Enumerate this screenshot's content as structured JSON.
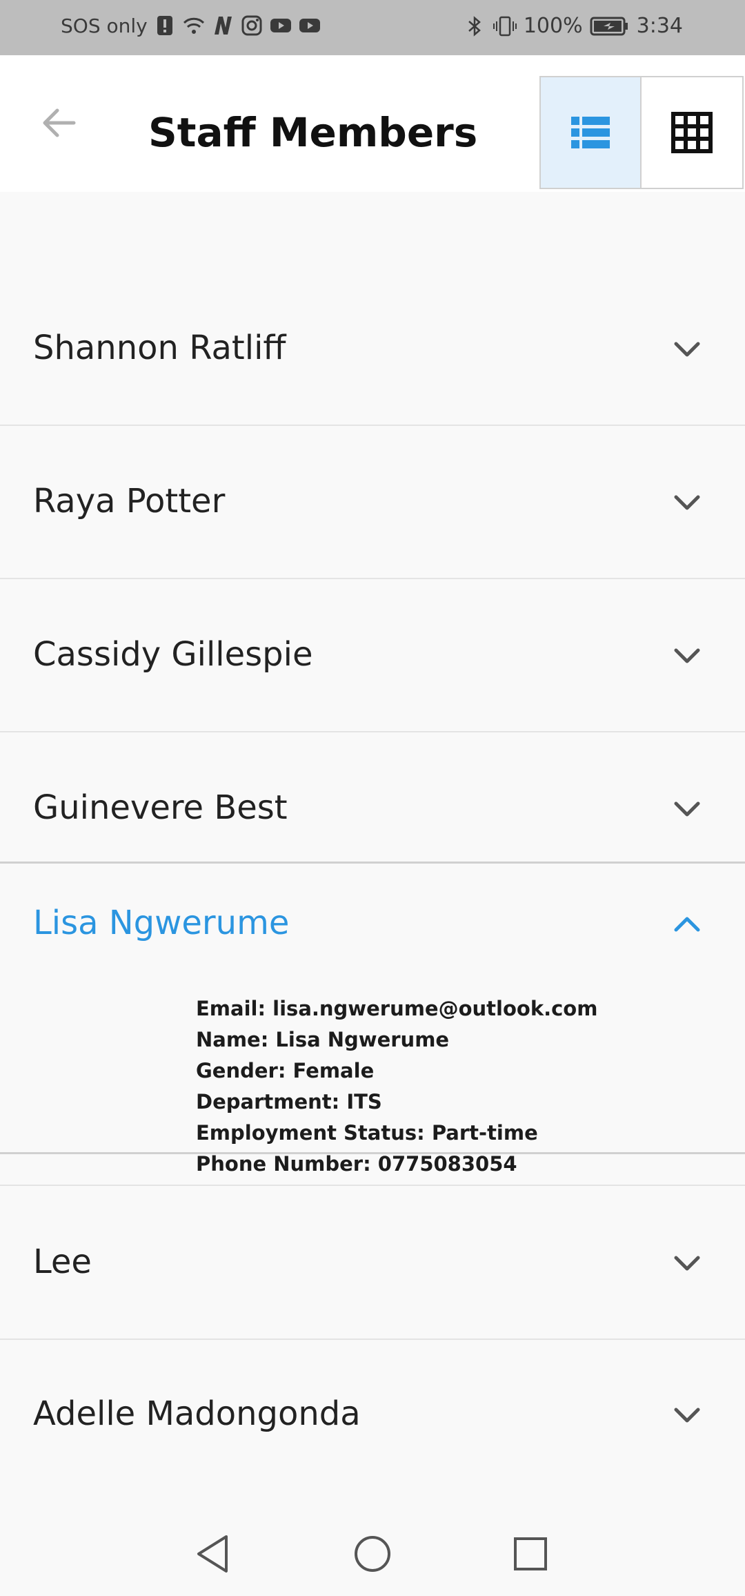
{
  "status_bar": {
    "carrier": "SOS only",
    "battery": "100%",
    "time": "3:34",
    "icons": [
      "alert-icon",
      "wifi-icon",
      "n-icon",
      "instagram-icon",
      "youtube-icon",
      "youtube-icon",
      "bluetooth-icon",
      "vibrate-icon",
      "battery-icon"
    ]
  },
  "app_bar": {
    "title": "Staff Members",
    "back_icon": "arrow-left-icon",
    "list_view_icon": "list-view-icon",
    "grid_view_icon": "grid-view-icon",
    "active_view": "list"
  },
  "staff": [
    {
      "name": "Shannon Ratliff"
    },
    {
      "name": "Raya Potter"
    },
    {
      "name": "Cassidy Gillespie"
    },
    {
      "name": "Guinevere Best"
    },
    {
      "name": "Lisa Ngwerume",
      "expanded": true,
      "details": {
        "email": "Email: lisa.ngwerume@outlook.com",
        "name": "Name: Lisa Ngwerume",
        "gender": "Gender: Female",
        "department": "Department: ITS",
        "employment_status": "Employment Status: Part-time",
        "phone": "Phone Number: 0775083054"
      }
    },
    {
      "name": "Lee"
    },
    {
      "name": "Adelle Madongonda"
    }
  ],
  "colors": {
    "accent": "#2b95e0",
    "status_bar": "#bdbdbd",
    "background": "#f9f9f9"
  },
  "nav_bar": {
    "icons": [
      "back-triangle-icon",
      "home-circle-icon",
      "recents-square-icon"
    ]
  }
}
